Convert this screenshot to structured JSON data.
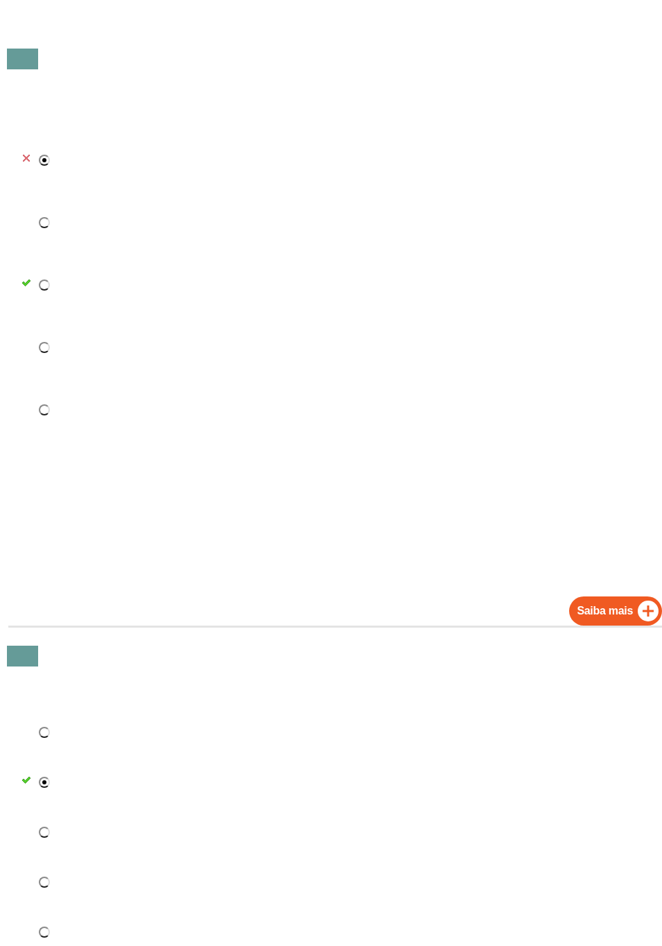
{
  "questions": [
    {
      "options": [
        {
          "selected": true,
          "wrong": true,
          "correct": false
        },
        {
          "selected": false,
          "wrong": false,
          "correct": false
        },
        {
          "selected": false,
          "wrong": false,
          "correct": true
        },
        {
          "selected": false,
          "wrong": false,
          "correct": false
        },
        {
          "selected": false,
          "wrong": false,
          "correct": false
        }
      ],
      "more_button": "Saiba mais"
    },
    {
      "options": [
        {
          "selected": false,
          "wrong": false,
          "correct": false
        },
        {
          "selected": true,
          "wrong": false,
          "correct": true
        },
        {
          "selected": false,
          "wrong": false,
          "correct": false
        },
        {
          "selected": false,
          "wrong": false,
          "correct": false
        },
        {
          "selected": false,
          "wrong": false,
          "correct": false
        }
      ]
    }
  ]
}
